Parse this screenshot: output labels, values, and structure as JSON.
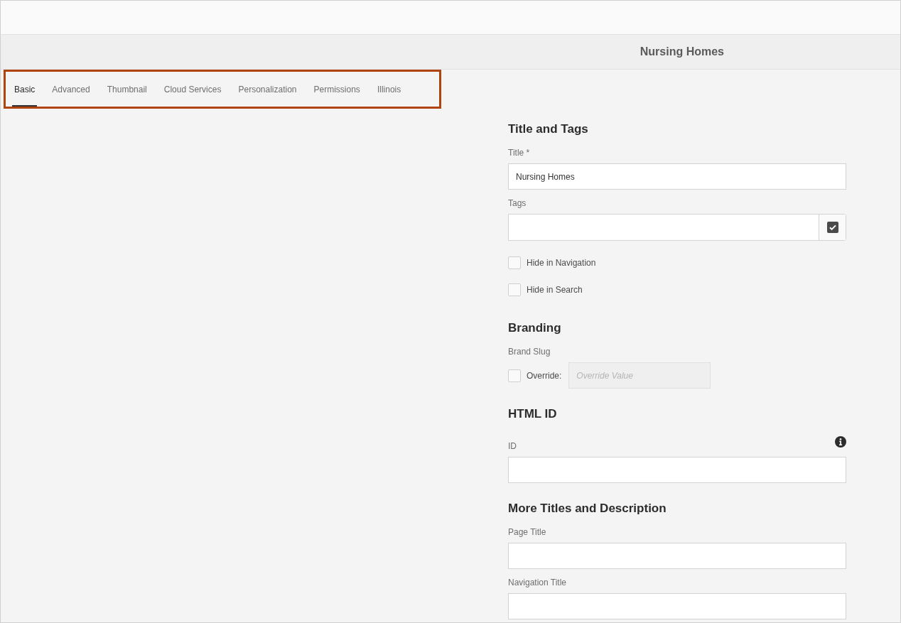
{
  "window": {
    "title": "Nursing Homes"
  },
  "tabs": [
    {
      "label": "Basic",
      "selected": true
    },
    {
      "label": "Advanced",
      "selected": false
    },
    {
      "label": "Thumbnail",
      "selected": false
    },
    {
      "label": "Cloud Services",
      "selected": false
    },
    {
      "label": "Personalization",
      "selected": false
    },
    {
      "label": "Permissions",
      "selected": false
    },
    {
      "label": "Illinois",
      "selected": false
    }
  ],
  "sections": [
    {
      "heading": "Title and Tags",
      "fields": [
        {
          "kind": "text",
          "label": "Title *",
          "value": "Nursing Homes"
        },
        {
          "kind": "tags",
          "label": "Tags"
        },
        {
          "kind": "checkbox",
          "label": "Hide in Navigation",
          "checked": false
        },
        {
          "kind": "checkbox",
          "label": "Hide in Search",
          "checked": false
        }
      ]
    },
    {
      "heading": "Branding",
      "fields": [
        {
          "kind": "label",
          "label": "Brand Slug"
        },
        {
          "kind": "override",
          "label": "Override:",
          "checked": false,
          "placeholder": "Override Value",
          "disabled": true
        }
      ]
    },
    {
      "heading": "HTML ID",
      "fields": [
        {
          "kind": "info_text",
          "label": "ID"
        }
      ]
    },
    {
      "heading": "More Titles and Description",
      "fields": [
        {
          "kind": "text",
          "label": "Page Title"
        },
        {
          "kind": "text",
          "label": "Navigation Title"
        }
      ]
    }
  ]
}
